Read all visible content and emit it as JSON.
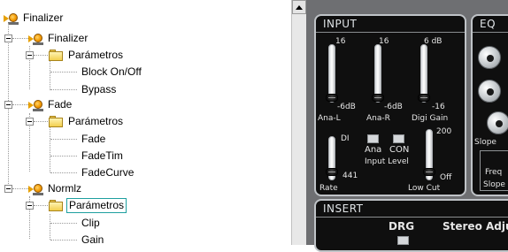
{
  "tree": {
    "root": "Finalizer",
    "items": [
      {
        "label": "Finalizer",
        "kind": "plugin"
      },
      {
        "label": "Parámetros",
        "kind": "folder"
      },
      {
        "label": "Block On/Off",
        "kind": "param"
      },
      {
        "label": "Bypass",
        "kind": "param"
      },
      {
        "label": "Fade",
        "kind": "plugin"
      },
      {
        "label": "Parámetros",
        "kind": "folder"
      },
      {
        "label": "Fade",
        "kind": "param"
      },
      {
        "label": "FadeTim",
        "kind": "param"
      },
      {
        "label": "FadeCurve",
        "kind": "param"
      },
      {
        "label": "Normlz",
        "kind": "plugin"
      },
      {
        "label": "Parámetros",
        "kind": "folder",
        "selected": true
      },
      {
        "label": "Clip",
        "kind": "param"
      },
      {
        "label": "Gain",
        "kind": "param"
      }
    ]
  },
  "scrollbar": {
    "up_icon": "up-arrow-icon"
  },
  "input_panel": {
    "title": "INPUT",
    "top_labels": [
      "16",
      "16",
      "6 dB"
    ],
    "fader_values": [
      "-6dB",
      "-6dB",
      "-16"
    ],
    "fader_names": [
      "Ana-L",
      "Ana-R",
      "Digi Gain"
    ],
    "di_label": "DI",
    "rate_value": "441",
    "rate_label": "Rate",
    "buttons": [
      "Ana",
      "CON"
    ],
    "input_level_label": "Input Level",
    "lowcut_top": "200",
    "lowcut_value": "Off",
    "lowcut_label": "Low Cut"
  },
  "eq_panel": {
    "title": "EQ",
    "slope_label": "Slope",
    "freq_label": "Freq",
    "slope_label2": "Slope"
  },
  "insert_panel": {
    "title": "INSERT",
    "drg_label": "DRG",
    "stereo_label": "Stereo Adju"
  },
  "colors": {
    "tree_background": "#ffffff",
    "selection_border": "#1ea0a0",
    "mixer_background": "#6e6f72",
    "panel_background": "#0f0f0f",
    "panel_border": "#bfc3c7"
  }
}
